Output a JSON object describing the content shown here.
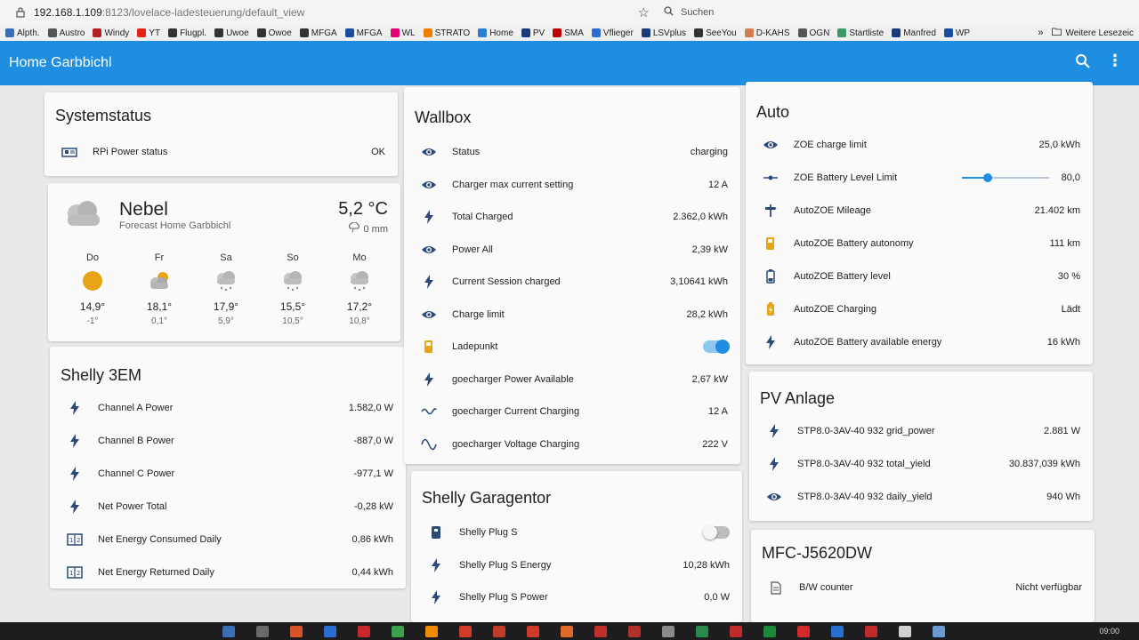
{
  "browser": {
    "url_host": "192.168.1.109",
    "url_rest": ":8123/lovelace-ladesteuerung/default_view",
    "search_placeholder": "Suchen",
    "bookmarks": [
      {
        "label": "Alpth.",
        "color": "#3b6fb5"
      },
      {
        "label": "Austro",
        "color": "#555555"
      },
      {
        "label": "Windy",
        "color": "#b22222"
      },
      {
        "label": "YT",
        "color": "#e62117"
      },
      {
        "label": "Flugpl.",
        "color": "#333333"
      },
      {
        "label": "Uwoe",
        "color": "#333333"
      },
      {
        "label": "Owoe",
        "color": "#333333"
      },
      {
        "label": "MFGA",
        "color": "#333333"
      },
      {
        "label": "MFGA",
        "color": "#1a4fa0"
      },
      {
        "label": "WL",
        "color": "#e20074"
      },
      {
        "label": "STRATO",
        "color": "#f07d00"
      },
      {
        "label": "Home",
        "color": "#2a7fd4"
      },
      {
        "label": "PV",
        "color": "#1a3a7a"
      },
      {
        "label": "SMA",
        "color": "#c00000"
      },
      {
        "label": "Vflieger",
        "color": "#2a6fd0"
      },
      {
        "label": "LSVplus",
        "color": "#1a3a7a"
      },
      {
        "label": "SeeYou",
        "color": "#333333"
      },
      {
        "label": "D-KAHS",
        "color": "#d08050"
      },
      {
        "label": "OGN",
        "color": "#555555"
      },
      {
        "label": "Startliste",
        "color": "#3a9a6a"
      },
      {
        "label": "Manfred",
        "color": "#1a3a7a"
      },
      {
        "label": "WP",
        "color": "#1a4fa0"
      }
    ],
    "more_label": "Weitere Lesezeic"
  },
  "app": {
    "title": "Home Garbbichl"
  },
  "systemstatus": {
    "title": "Systemstatus",
    "rows": [
      {
        "label": "RPi Power status",
        "value": "OK",
        "icon": "raspberry-pi-icon"
      }
    ]
  },
  "weather": {
    "condition": "Nebel",
    "subtitle": "Forecast Home Garbbichl",
    "temperature": "5,2 °C",
    "precipitation": "0 mm",
    "forecast": [
      {
        "day": "Do",
        "icon": "sunny",
        "high": "14,9°",
        "low": "-1°"
      },
      {
        "day": "Fr",
        "icon": "partly-cloudy",
        "high": "18,1°",
        "low": "0,1°"
      },
      {
        "day": "Sa",
        "icon": "snowy-rainy",
        "high": "17,9°",
        "low": "5,9°"
      },
      {
        "day": "So",
        "icon": "snowy-rainy",
        "high": "15,5°",
        "low": "10,5°"
      },
      {
        "day": "Mo",
        "icon": "snowy-rainy",
        "high": "17,2°",
        "low": "10,8°"
      }
    ]
  },
  "shelly3em": {
    "title": "Shelly 3EM",
    "rows": [
      {
        "label": "Channel A Power",
        "value": "1.582,0 W",
        "icon": "flash-icon"
      },
      {
        "label": "Channel B Power",
        "value": "-887,0 W",
        "icon": "flash-icon"
      },
      {
        "label": "Channel C Power",
        "value": "-977,1 W",
        "icon": "flash-icon"
      },
      {
        "label": "Net Power Total",
        "value": "-0,28 kW",
        "icon": "flash-icon"
      },
      {
        "label": "Net Energy Consumed Daily",
        "value": "0,86 kWh",
        "icon": "counter-icon"
      },
      {
        "label": "Net Energy Returned Daily",
        "value": "0,44 kWh",
        "icon": "counter-icon"
      }
    ]
  },
  "wallbox": {
    "title": "Wallbox",
    "rows": [
      {
        "label": "Status",
        "value": "charging",
        "icon": "eye-icon"
      },
      {
        "label": "Charger max current setting",
        "value": "12 A",
        "icon": "eye-icon"
      },
      {
        "label": "Total Charged",
        "value": "2.362,0 kWh",
        "icon": "flash-icon"
      },
      {
        "label": "Power All",
        "value": "2,39 kW",
        "icon": "eye-icon"
      },
      {
        "label": "Current Session charged",
        "value": "3,10641 kWh",
        "icon": "flash-icon"
      },
      {
        "label": "Charge limit",
        "value": "28,2 kWh",
        "icon": "eye-icon"
      },
      {
        "label": "Ladepunkt",
        "value": "",
        "icon": "ev-station-icon",
        "toggle": true
      },
      {
        "label": "goecharger Power Available",
        "value": "2,67 kW",
        "icon": "flash-icon"
      },
      {
        "label": "goecharger Current Charging",
        "value": "12 A",
        "icon": "current-ac-icon"
      },
      {
        "label": "goecharger Voltage Charging",
        "value": "222 V",
        "icon": "sine-wave-icon"
      }
    ]
  },
  "garagentor": {
    "title": "Shelly Garagentor",
    "rows": [
      {
        "label": "Shelly Plug S",
        "value": "",
        "icon": "plug-icon",
        "toggle": false
      },
      {
        "label": "Shelly Plug S Energy",
        "value": "10,28 kWh",
        "icon": "flash-icon"
      },
      {
        "label": "Shelly Plug S Power",
        "value": "0,0 W",
        "icon": "flash-icon"
      }
    ]
  },
  "auto": {
    "title": "Auto",
    "rows": [
      {
        "label": "ZOE charge limit",
        "value": "25,0 kWh",
        "icon": "eye-icon"
      },
      {
        "label": "ZOE Battery Level Limit",
        "value": "80,0",
        "icon": "ray-vertex-icon",
        "slider": 0.3
      },
      {
        "label": "AutoZOE Mileage",
        "value": "21.402 km",
        "icon": "sign-direction-icon"
      },
      {
        "label": "AutoZOE Battery autonomy",
        "value": "111 km",
        "icon": "ev-station-icon"
      },
      {
        "label": "AutoZOE Battery level",
        "value": "30 %",
        "icon": "battery-icon"
      },
      {
        "label": "AutoZOE Charging",
        "value": "Lädt",
        "icon": "battery-charging-icon"
      },
      {
        "label": "AutoZOE Battery available energy",
        "value": "16 kWh",
        "icon": "flash-icon"
      }
    ]
  },
  "pv": {
    "title": "PV Anlage",
    "rows": [
      {
        "label": "STP8.0-3AV-40 932 grid_power",
        "value": "2.881 W",
        "icon": "flash-icon"
      },
      {
        "label": "STP8.0-3AV-40 932 total_yield",
        "value": "30.837,039 kWh",
        "icon": "flash-icon"
      },
      {
        "label": "STP8.0-3AV-40 932 daily_yield",
        "value": "940 Wh",
        "icon": "eye-icon"
      }
    ]
  },
  "mfc": {
    "title": "MFC-J5620DW",
    "rows": [
      {
        "label": "B/W counter",
        "value": "Nicht verfügbar",
        "icon": "file-document-icon"
      }
    ]
  },
  "taskbar": {
    "clock": "09:00",
    "apps": [
      "#3b6fb5",
      "#6a6a6a",
      "#d9532a",
      "#2a6fd0",
      "#c8282a",
      "#3aa04a",
      "#f08a00",
      "#d23a2a",
      "#c03a2a",
      "#d03a2a",
      "#e06a2a",
      "#c0302a",
      "#b0302a",
      "#8a8a8a",
      "#2a8a4a",
      "#c02a2a",
      "#1a8a3a",
      "#d02a2a",
      "#2a6fd0",
      "#c02a2a",
      "#d0d0d0",
      "#6a9ad0"
    ]
  }
}
